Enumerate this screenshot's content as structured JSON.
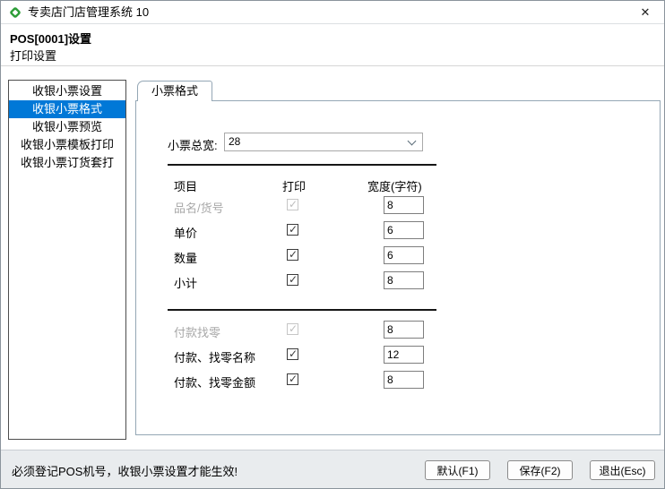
{
  "window": {
    "title": "专卖店门店管理系统 10",
    "close_label": "✕"
  },
  "header": {
    "title": "POS[0001]设置",
    "subtitle": "打印设置"
  },
  "sidebar": {
    "items": [
      {
        "name": "sidebar-item-receipt-settings",
        "label": "收银小票设置",
        "selected": false
      },
      {
        "name": "sidebar-item-receipt-format",
        "label": "收银小票格式",
        "selected": true
      },
      {
        "name": "sidebar-item-receipt-preview",
        "label": "收银小票预览",
        "selected": false
      },
      {
        "name": "sidebar-item-receipt-template-print",
        "label": "收银小票模板打印",
        "selected": false
      },
      {
        "name": "sidebar-item-receipt-order-print",
        "label": "收银小票订货套打",
        "selected": false
      }
    ]
  },
  "tab": {
    "label": "小票格式"
  },
  "form": {
    "width_label": "小票总宽:",
    "width_value": "28",
    "columns": {
      "item": "项目",
      "print": "打印",
      "width": "宽度(字符)"
    },
    "groups": [
      {
        "rows": [
          {
            "label": "品名/货号",
            "checked": true,
            "disabled": true,
            "width": "8"
          },
          {
            "label": "单价",
            "checked": true,
            "disabled": false,
            "width": "6"
          },
          {
            "label": "数量",
            "checked": true,
            "disabled": false,
            "width": "6"
          },
          {
            "label": "小计",
            "checked": true,
            "disabled": false,
            "width": "8"
          }
        ]
      },
      {
        "rows": [
          {
            "label": "付款找零",
            "checked": true,
            "disabled": true,
            "width": "8"
          },
          {
            "label": "付款、找零名称",
            "checked": true,
            "disabled": false,
            "width": "12"
          },
          {
            "label": "付款、找零金额",
            "checked": true,
            "disabled": false,
            "width": "8"
          }
        ]
      }
    ]
  },
  "statusbar": {
    "message": "必须登记POS机号，收银小票设置才能生效!",
    "buttons": [
      {
        "name": "default-button",
        "label": "默认(F1)"
      },
      {
        "name": "save-button",
        "label": "保存(F2)"
      },
      {
        "name": "exit-button",
        "label": "退出(Esc)"
      }
    ]
  },
  "colors": {
    "accent": "#0078d7",
    "panel_border": "#94a7b5",
    "disabled_text": "#a8a8a8",
    "icon_green": "#2f9e3a"
  }
}
